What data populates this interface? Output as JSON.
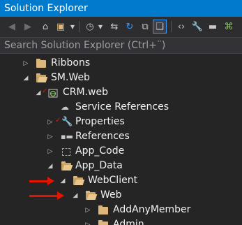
{
  "window": {
    "title": "Solution Explorer"
  },
  "search": {
    "placeholder": "Search Solution Explorer (Ctrl+¨)"
  },
  "colors": {
    "accent": "#007acc",
    "folder": "#dcb67a",
    "annotation_arrow": "#e51400"
  },
  "toolbar": {
    "icons": [
      "back-icon",
      "forward-icon",
      "home-icon",
      "switch-views-icon",
      "dropdown-icon",
      "history-icon",
      "dropdown-icon",
      "sync-icon",
      "refresh-icon",
      "collapse-all-icon",
      "show-all-files-icon",
      "view-code-icon",
      "properties-icon",
      "preview-icon",
      "class-diagram-icon"
    ]
  },
  "tree": [
    {
      "label": "Ribbons",
      "icon": "folder-icon",
      "expanded": false
    },
    {
      "label": "SM.Web",
      "icon": "folder-open-icon",
      "expanded": true
    },
    {
      "label": "CRM.web",
      "icon": "web-project-icon",
      "expanded": true,
      "checked_out": true
    },
    {
      "label": "Service References",
      "icon": "service-reference-icon",
      "expanded": null
    },
    {
      "label": "Properties",
      "icon": "wrench-icon",
      "expanded": false,
      "checked_out": true
    },
    {
      "label": "References",
      "icon": "references-icon",
      "expanded": false
    },
    {
      "label": "App_Code",
      "icon": "app-code-folder-icon",
      "expanded": false
    },
    {
      "label": "App_Data",
      "icon": "folder-open-icon",
      "expanded": true
    },
    {
      "label": "WebClient",
      "icon": "folder-open-icon",
      "expanded": true,
      "annotated": true
    },
    {
      "label": "Web",
      "icon": "folder-open-icon",
      "expanded": true,
      "annotated": true
    },
    {
      "label": "AddAnyMember",
      "icon": "folder-icon",
      "expanded": false
    },
    {
      "label": "Admin",
      "icon": "folder-icon",
      "expanded": false
    }
  ]
}
